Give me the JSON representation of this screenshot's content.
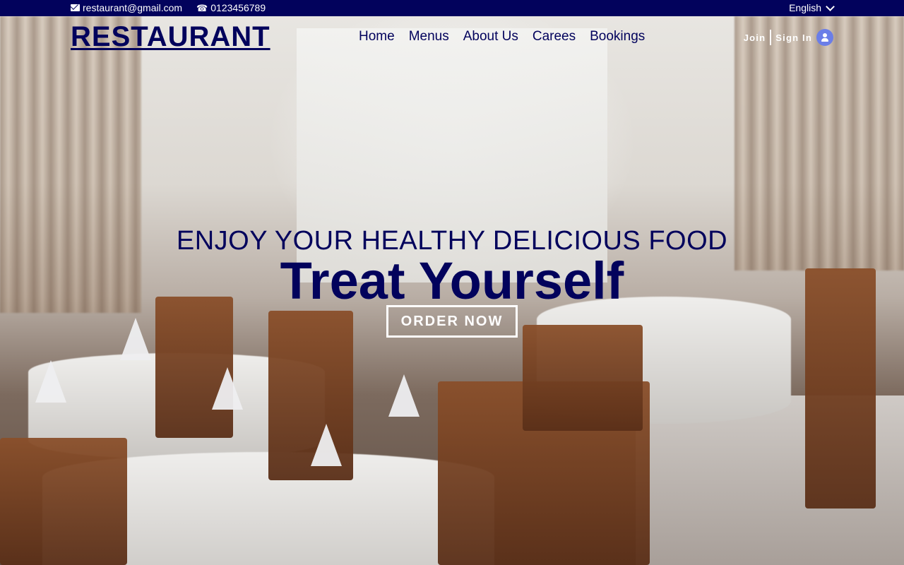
{
  "topbar": {
    "email": "restaurant@gmail.com",
    "phone": "0123456789",
    "language": "English",
    "email_icon": "envelope-icon",
    "phone_icon": "phone-icon",
    "language_icon": "chevron-down-icon"
  },
  "header": {
    "brand": "RESTAURANT",
    "nav": [
      "Home",
      "Menus",
      "About Us",
      "Carees",
      "Bookings"
    ],
    "join": "Join",
    "sign_in": "Sign In",
    "user_icon": "user-icon"
  },
  "hero": {
    "subtitle": "ENJOY YOUR HEALTHY DELICIOUS FOOD",
    "title": "Treat Yourself",
    "cta": "ORDER NOW"
  },
  "colors": {
    "navy": "#02025c",
    "avatar_bg": "#6b7ee8",
    "white": "#ffffff"
  }
}
